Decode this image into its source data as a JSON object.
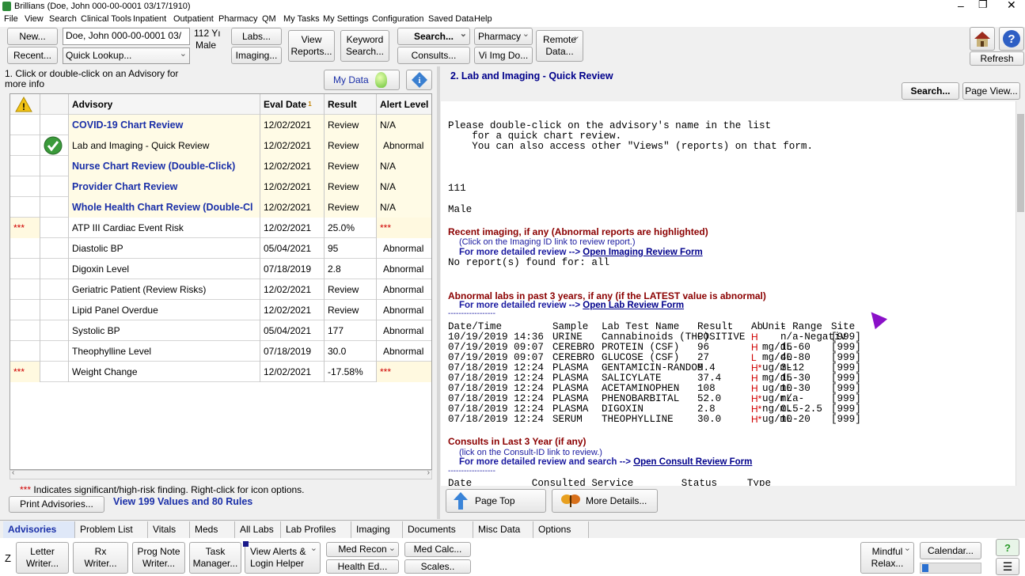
{
  "window": {
    "title": "Brillians (Doe, John  000-00-0001  03/17/1910)"
  },
  "menu": [
    "File",
    "View",
    "Search",
    "Clinical Tools",
    "Inpatient",
    "Outpatient",
    "Pharmacy",
    "QM",
    "My Tasks",
    "My Settings",
    "Configuration",
    "Saved Data",
    "Help"
  ],
  "toolbar": {
    "new": "New...",
    "recent": "Recent...",
    "patient_field": "Doe, John  000-00-0001  03/",
    "quick_lookup": "Quick Lookup...",
    "age": "112 Yı",
    "sex": "Male",
    "labs": "Labs...",
    "imaging": "Imaging...",
    "view_reports_1": "View",
    "view_reports_2": "Reports...",
    "keyword_1": "Keyword",
    "keyword_2": "Search...",
    "search": "Search...",
    "consults": "Consults...",
    "pharmacy": "Pharmacy",
    "vi_img": "Vi Img Do...",
    "remote_1": "Remote",
    "remote_2": "Data...",
    "refresh": "Refresh"
  },
  "left": {
    "instruction": "1. Click or double-click on an Advisory for more info",
    "my_data": "My Data",
    "columns": [
      "Advisory",
      "Eval Date",
      "Result",
      "Alert Level"
    ],
    "rows": [
      {
        "flag": "",
        "checked": false,
        "name": "COVID-19 Chart Review",
        "date": "12/02/2021",
        "result": "Review",
        "alert": "N/A",
        "bold": true
      },
      {
        "flag": "",
        "checked": true,
        "name": "Lab and Imaging - Quick Review",
        "date": "12/02/2021",
        "result": "Review",
        "alert": "Abnormal",
        "bold": false
      },
      {
        "flag": "",
        "checked": false,
        "name": "Nurse Chart Review (Double-Click)",
        "date": "12/02/2021",
        "result": "Review",
        "alert": "N/A",
        "bold": true
      },
      {
        "flag": "",
        "checked": false,
        "name": "Provider Chart Review",
        "date": "12/02/2021",
        "result": "Review",
        "alert": "N/A",
        "bold": true
      },
      {
        "flag": "",
        "checked": false,
        "name": "Whole Health Chart Review (Double-Cl",
        "date": "12/02/2021",
        "result": "Review",
        "alert": "N/A",
        "bold": true
      },
      {
        "flag": "***",
        "checked": false,
        "name": "ATP III Cardiac Event Risk",
        "date": "12/02/2021",
        "result": "25.0%",
        "alert": "***",
        "bold": false
      },
      {
        "flag": "",
        "checked": false,
        "name": "Diastolic BP",
        "date": "05/04/2021",
        "result": "95",
        "alert": "Abnormal",
        "bold": false
      },
      {
        "flag": "",
        "checked": false,
        "name": "Digoxin Level",
        "date": "07/18/2019",
        "result": "2.8",
        "alert": "Abnormal",
        "bold": false
      },
      {
        "flag": "",
        "checked": false,
        "name": "Geriatric Patient (Review Risks)",
        "date": "12/02/2021",
        "result": "Review",
        "alert": "Abnormal",
        "bold": false
      },
      {
        "flag": "",
        "checked": false,
        "name": "Lipid Panel Overdue",
        "date": "12/02/2021",
        "result": "Review",
        "alert": "Abnormal",
        "bold": false
      },
      {
        "flag": "",
        "checked": false,
        "name": "Systolic BP",
        "date": "05/04/2021",
        "result": "177",
        "alert": "Abnormal",
        "bold": false
      },
      {
        "flag": "",
        "checked": false,
        "name": "Theophylline Level",
        "date": "07/18/2019",
        "result": "30.0",
        "alert": "Abnormal",
        "bold": false
      },
      {
        "flag": "***",
        "checked": false,
        "name": "Weight Change",
        "date": "12/02/2021",
        "result": "-17.58%",
        "alert": "***",
        "bold": false
      }
    ],
    "footnote_stars": "***",
    "footnote": "Indicates significant/high-risk finding. Right-click for icon options.",
    "print": "Print Advisories...",
    "view_values": "View 199 Values and 80 Rules"
  },
  "right": {
    "heading": "2.  Lab and Imaging - Quick Review",
    "search": "Search...",
    "page_view": "Page View...",
    "intro": "Please double-click on the advisory's name in the list\n    for a quick chart review.\n    You can also access other \"Views\" (reports) on that form.",
    "age": "111",
    "sex": "Male",
    "imaging_title": "Recent imaging, if any (Abnormal reports are highlighted)",
    "imaging_note": "(Click on the Imaging ID link to review report.)",
    "imaging_detail": "For more detailed review -->",
    "imaging_link": "Open Imaging Review Form",
    "imaging_none": "No report(s) found for: all",
    "labs_title": "Abnormal labs in past 3 years, if any (if the LATEST value is abnormal)",
    "labs_detail": "For more detailed review -->",
    "labs_link": "Open Lab Review Form",
    "divider": "------------------",
    "lab_header": [
      "Date/Time",
      "Sample",
      "Lab Test Name",
      "Result",
      "Ab",
      "Unit",
      "- Range",
      "Site"
    ],
    "labs": [
      [
        "10/19/2019 14:36",
        "URINE",
        "Cannabinoids (THC)",
        "POSITIVE",
        "H",
        "",
        "n/a-Negativ",
        "[999]"
      ],
      [
        "07/19/2019 09:07",
        "CEREBRO",
        "PROTEIN (CSF)",
        "96",
        "H",
        "mg/dL",
        "15-60",
        "[999]"
      ],
      [
        "07/19/2019 09:07",
        "CEREBRO",
        "GLUCOSE (CSF)",
        "27",
        "L",
        "mg/dL",
        "40-80",
        "[999]"
      ],
      [
        "07/18/2019 12:24",
        "PLASMA",
        "GENTAMICIN-RANDOM",
        "9.4",
        "H*",
        "ug/mL",
        "3-12",
        "[999]"
      ],
      [
        "07/18/2019 12:24",
        "PLASMA",
        "SALICYLATE",
        "37.4",
        "H",
        "mg/dL",
        "15-30",
        "[999]"
      ],
      [
        "07/18/2019 12:24",
        "PLASMA",
        "ACETAMINOPHEN",
        "108",
        "H",
        "ug/mL",
        "10-30",
        "[999]"
      ],
      [
        "07/18/2019 12:24",
        "PLASMA",
        "PHENOBARBITAL",
        "52.0",
        "H*",
        "ug/mL",
        "n/a-",
        "[999]"
      ],
      [
        "07/18/2019 12:24",
        "PLASMA",
        "DIGOXIN",
        "2.8",
        "H*",
        "ng/mL",
        "0.5-2.5",
        "[999]"
      ],
      [
        "07/18/2019 12:24",
        "SERUM",
        "THEOPHYLLINE",
        "30.0",
        "H*",
        "ug/mL",
        "10-20",
        "[999]"
      ]
    ],
    "consults_title": "Consults in Last 3 Year (if any)",
    "consults_note": "(lick on the Consult-ID link to review.)",
    "consults_detail": "For more detailed review and search -->",
    "consults_link": "Open Consult Review Form",
    "consults_header": "Date          Consulted Service        Status     Type",
    "page_top": "Page Top",
    "more_details": "More Details..."
  },
  "tabs": [
    "Advisories",
    "Problem List",
    "Vitals",
    "Meds",
    "All Labs",
    "Lab Profiles",
    "Imaging",
    "Documents",
    "Misc Data",
    "Options"
  ],
  "bottom": {
    "z": "Z",
    "letter_1": "Letter",
    "letter_2": "Writer...",
    "rx_1": "Rx",
    "rx_2": "Writer...",
    "prog_1": "Prog Note",
    "prog_2": "Writer...",
    "task_1": "Task",
    "task_2": "Manager...",
    "alerts_1": "View Alerts &",
    "alerts_2": "Login Helper",
    "med_recon": "Med Recon",
    "health_ed": "Health Ed...",
    "med_calc": "Med Calc...",
    "scales": "Scales..",
    "mindful_1": "Mindful",
    "mindful_2": "Relax...",
    "calendar": "Calendar..."
  },
  "colors": {
    "accent_blue": "#1a2fa8",
    "alert_red": "#d00000",
    "section_red": "#8b0000",
    "row_highlight": "#fffbe6"
  }
}
